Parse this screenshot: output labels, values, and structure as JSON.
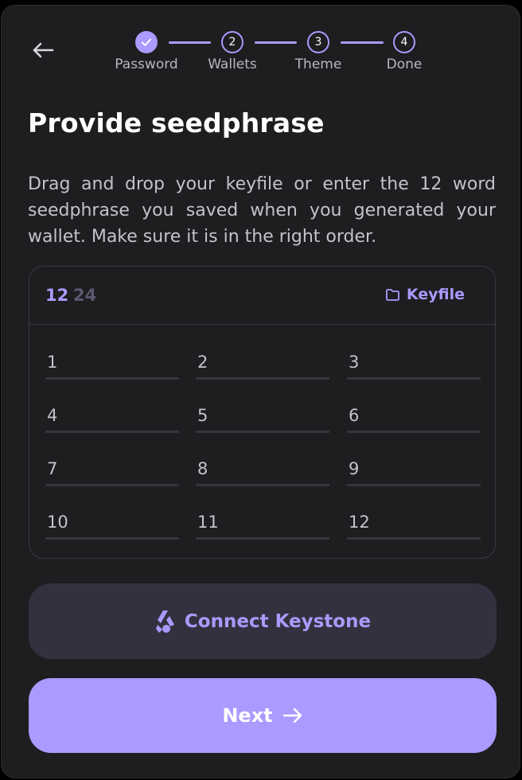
{
  "steps": [
    {
      "label": "Password",
      "number": "",
      "state": "done"
    },
    {
      "label": "Wallets",
      "number": "2",
      "state": "current"
    },
    {
      "label": "Theme",
      "number": "3",
      "state": "pending"
    },
    {
      "label": "Done",
      "number": "4",
      "state": "pending"
    }
  ],
  "title": "Provide seedphrase",
  "description": "Drag and drop your keyfile or enter the 12 word seedphrase you saved when you generated your wallet. Make sure it is in the right order.",
  "seed": {
    "length_options": [
      "12",
      "24"
    ],
    "selected_length": "12",
    "keyfile_label": "Keyfile",
    "words": [
      "1",
      "2",
      "3",
      "4",
      "5",
      "6",
      "7",
      "8",
      "9",
      "10",
      "11",
      "12"
    ]
  },
  "buttons": {
    "keystone_label": "Connect Keystone",
    "next_label": "Next"
  },
  "colors": {
    "accent": "#ab9aff",
    "background": "#1e1d1f",
    "keystone_bg": "#35303f"
  }
}
